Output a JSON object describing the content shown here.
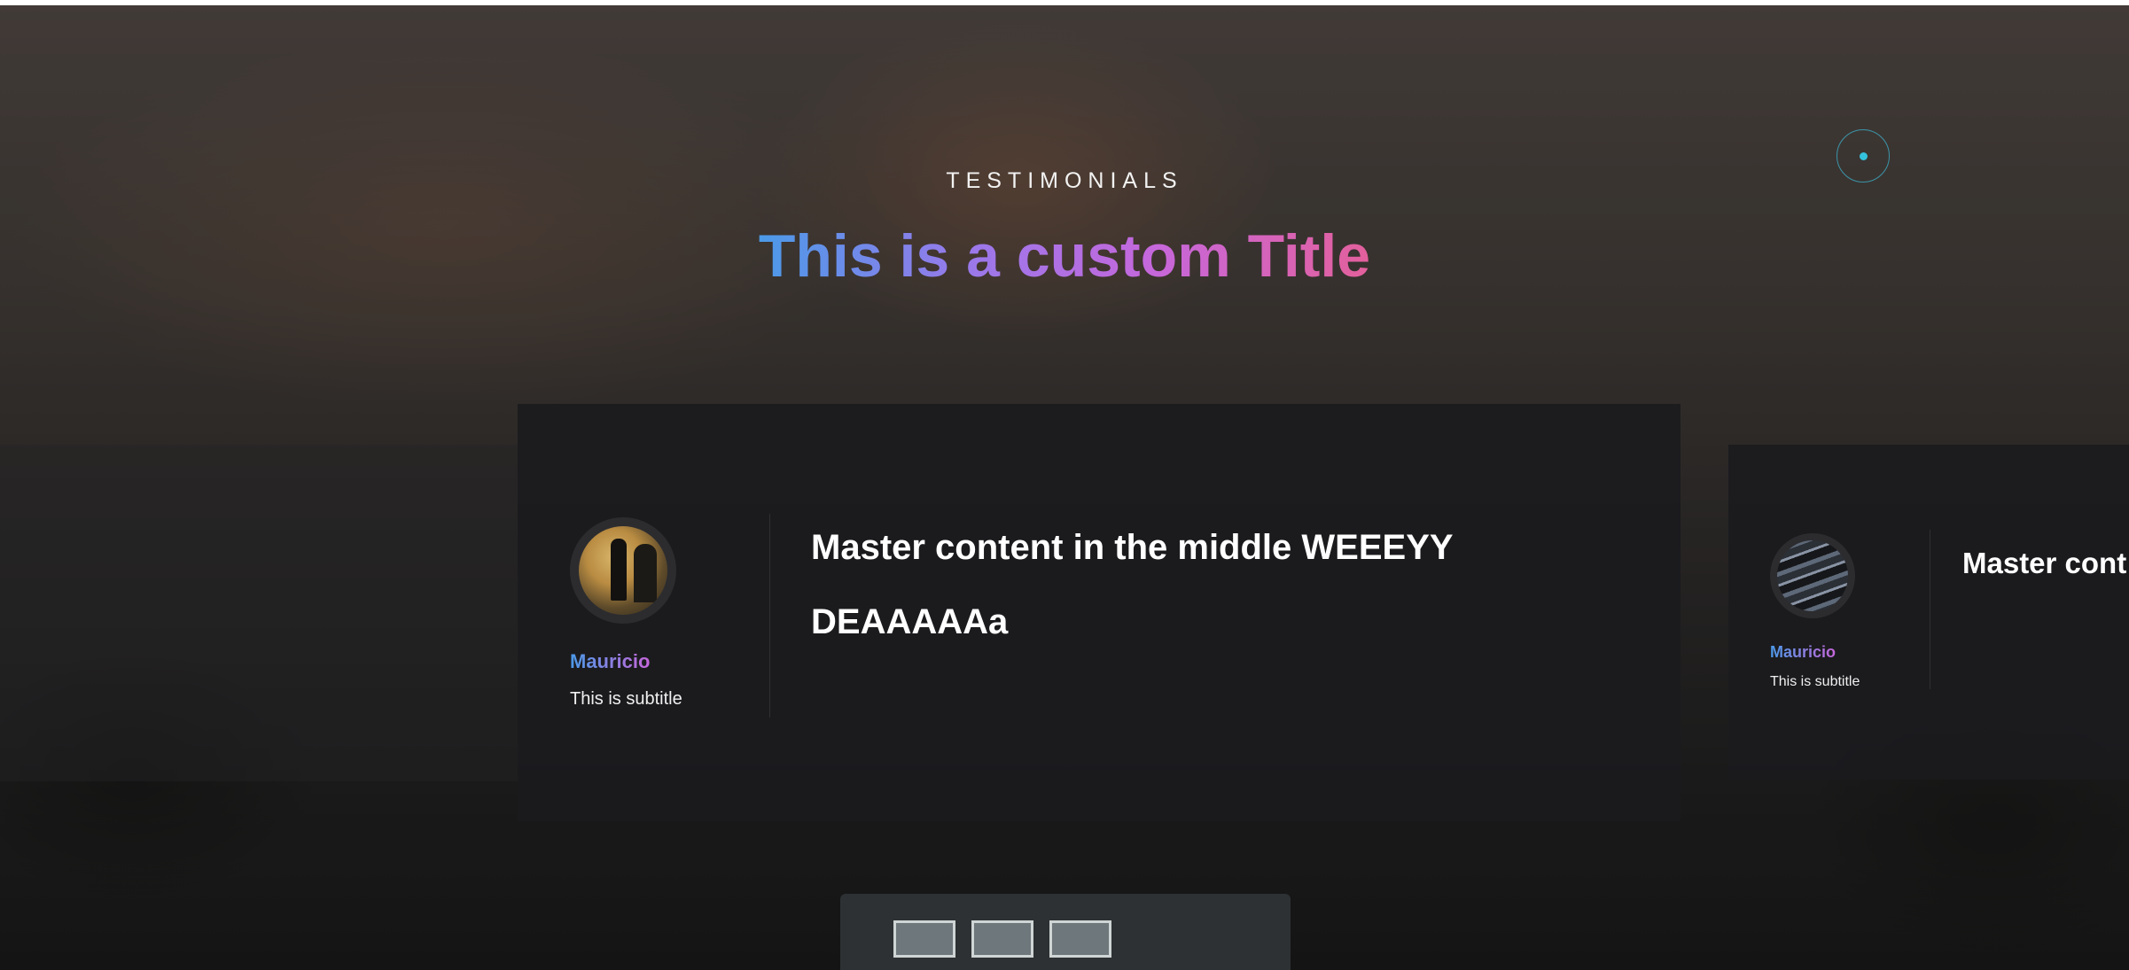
{
  "section": {
    "eyebrow": "TESTIMONIALS",
    "title": "This is a custom Title"
  },
  "testimonials": [
    {
      "name": "Mauricio",
      "subtitle": "This is subtitle",
      "quote": "Master content in the middle WEEEYY DEAAAAAa"
    },
    {
      "name": "Mauricio",
      "subtitle": "This is subtitle",
      "quote": "Master cont DEAAAAAa"
    }
  ],
  "theme": {
    "accent_start": "#4b9ae8",
    "accent_end": "#e3609c",
    "card_bg": "#1b1b1e",
    "indicator": "#34c1dd"
  }
}
